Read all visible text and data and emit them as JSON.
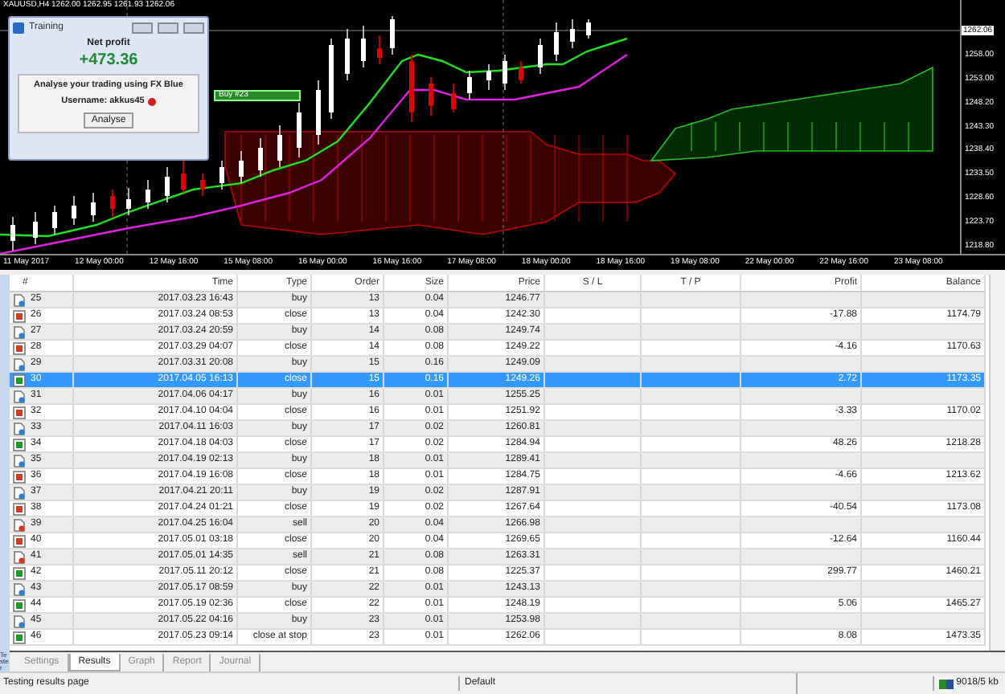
{
  "chart": {
    "header": "XAUUSD,H4  1262.00 1262.95 1261.93 1262.06",
    "current_price": "1262.06",
    "trade_label": "Buy #23",
    "price_labels": [
      "1258.00",
      "1253.00",
      "1248.20",
      "1243.30",
      "1238.40",
      "1233.50",
      "1228.60",
      "1223.70",
      "1218.80"
    ],
    "date_labels": [
      "11 May 2017",
      "12 May 00:00",
      "12 May 16:00",
      "15 May 08:00",
      "16 May 00:00",
      "16 May 16:00",
      "17 May 08:00",
      "18 May 00:00",
      "18 May 16:00",
      "19 May 08:00",
      "22 May 00:00",
      "22 May 16:00",
      "23 May 08:00"
    ]
  },
  "training_window": {
    "title": "Training",
    "net_profit_label": "Net profit",
    "net_profit": "+473.36",
    "prompt": "Analyse your trading using FX Blue",
    "username": "Username: akkus45",
    "button": "Analyse"
  },
  "table": {
    "columns": [
      "#",
      "Time",
      "Type",
      "Order",
      "Size",
      "Price",
      "S / L",
      "T / P",
      "Profit",
      "Balance"
    ],
    "rows": [
      {
        "kind": "buy",
        "selected": false,
        "cells": [
          "25",
          "2017.03.23 16:43",
          "buy",
          "13",
          "0.04",
          "1246.77",
          "",
          "",
          "",
          ""
        ]
      },
      {
        "kind": "close-loss",
        "selected": false,
        "cells": [
          "26",
          "2017.03.24 08:53",
          "close",
          "13",
          "0.04",
          "1242.30",
          "",
          "",
          "-17.88",
          "1174.79"
        ]
      },
      {
        "kind": "buy",
        "selected": false,
        "cells": [
          "27",
          "2017.03.24 20:59",
          "buy",
          "14",
          "0.08",
          "1249.74",
          "",
          "",
          "",
          ""
        ]
      },
      {
        "kind": "close-loss",
        "selected": false,
        "cells": [
          "28",
          "2017.03.29 04:07",
          "close",
          "14",
          "0.08",
          "1249.22",
          "",
          "",
          "-4.16",
          "1170.63"
        ]
      },
      {
        "kind": "buy",
        "selected": false,
        "cells": [
          "29",
          "2017.03.31 20:08",
          "buy",
          "15",
          "0.16",
          "1249.09",
          "",
          "",
          "",
          ""
        ]
      },
      {
        "kind": "close-profit",
        "selected": true,
        "cells": [
          "30",
          "2017.04.05 16:13",
          "close",
          "15",
          "0.16",
          "1249.26",
          "",
          "",
          "2.72",
          "1173.35"
        ]
      },
      {
        "kind": "buy",
        "selected": false,
        "cells": [
          "31",
          "2017.04.06 04:17",
          "buy",
          "16",
          "0.01",
          "1255.25",
          "",
          "",
          "",
          ""
        ]
      },
      {
        "kind": "close-loss",
        "selected": false,
        "cells": [
          "32",
          "2017.04.10 04:04",
          "close",
          "16",
          "0.01",
          "1251.92",
          "",
          "",
          "-3.33",
          "1170.02"
        ]
      },
      {
        "kind": "buy",
        "selected": false,
        "cells": [
          "33",
          "2017.04.11 16:03",
          "buy",
          "17",
          "0.02",
          "1260.81",
          "",
          "",
          "",
          ""
        ]
      },
      {
        "kind": "close-profit",
        "selected": false,
        "cells": [
          "34",
          "2017.04.18 04:03",
          "close",
          "17",
          "0.02",
          "1284.94",
          "",
          "",
          "48.26",
          "1218.28"
        ]
      },
      {
        "kind": "buy",
        "selected": false,
        "cells": [
          "35",
          "2017.04.19 02:13",
          "buy",
          "18",
          "0.01",
          "1289.41",
          "",
          "",
          "",
          ""
        ]
      },
      {
        "kind": "close-loss",
        "selected": false,
        "cells": [
          "36",
          "2017.04.19 16:08",
          "close",
          "18",
          "0.01",
          "1284.75",
          "",
          "",
          "-4.66",
          "1213.62"
        ]
      },
      {
        "kind": "buy",
        "selected": false,
        "cells": [
          "37",
          "2017.04.21 20:11",
          "buy",
          "19",
          "0.02",
          "1287.91",
          "",
          "",
          "",
          ""
        ]
      },
      {
        "kind": "close-loss",
        "selected": false,
        "cells": [
          "38",
          "2017.04.24 01:21",
          "close",
          "19",
          "0.02",
          "1267.64",
          "",
          "",
          "-40.54",
          "1173.08"
        ]
      },
      {
        "kind": "sell",
        "selected": false,
        "cells": [
          "39",
          "2017.04.25 16:04",
          "sell",
          "20",
          "0.04",
          "1266.98",
          "",
          "",
          "",
          ""
        ]
      },
      {
        "kind": "close-loss",
        "selected": false,
        "cells": [
          "40",
          "2017.05.01 03:18",
          "close",
          "20",
          "0.04",
          "1269.65",
          "",
          "",
          "-12.64",
          "1160.44"
        ]
      },
      {
        "kind": "sell",
        "selected": false,
        "cells": [
          "41",
          "2017.05.01 14:35",
          "sell",
          "21",
          "0.08",
          "1263.31",
          "",
          "",
          "",
          ""
        ]
      },
      {
        "kind": "close-profit",
        "selected": false,
        "cells": [
          "42",
          "2017.05.11 20:12",
          "close",
          "21",
          "0.08",
          "1225.37",
          "",
          "",
          "299.77",
          "1460.21"
        ]
      },
      {
        "kind": "buy",
        "selected": false,
        "cells": [
          "43",
          "2017.05.17 08:59",
          "buy",
          "22",
          "0.01",
          "1243.13",
          "",
          "",
          "",
          ""
        ]
      },
      {
        "kind": "close-profit",
        "selected": false,
        "cells": [
          "44",
          "2017.05.19 02:36",
          "close",
          "22",
          "0.01",
          "1248.19",
          "",
          "",
          "5.06",
          "1465.27"
        ]
      },
      {
        "kind": "buy",
        "selected": false,
        "cells": [
          "45",
          "2017.05.22 04:16",
          "buy",
          "23",
          "0.01",
          "1253.98",
          "",
          "",
          "",
          ""
        ]
      },
      {
        "kind": "close-profit",
        "selected": false,
        "cells": [
          "46",
          "2017.05.23 09:14",
          "close at stop",
          "23",
          "0.01",
          "1262.06",
          "",
          "",
          "8.08",
          "1473.35"
        ]
      }
    ]
  },
  "side_label": "Tester",
  "tabs": [
    {
      "label": "Settings",
      "selected": false
    },
    {
      "label": "Results",
      "selected": true
    },
    {
      "label": "Graph",
      "selected": false
    },
    {
      "label": "Report",
      "selected": false
    },
    {
      "label": "Journal",
      "selected": false
    }
  ],
  "status_bar": {
    "message": "Testing results page",
    "profile": "Default",
    "traffic": "9018/5 kb"
  }
}
